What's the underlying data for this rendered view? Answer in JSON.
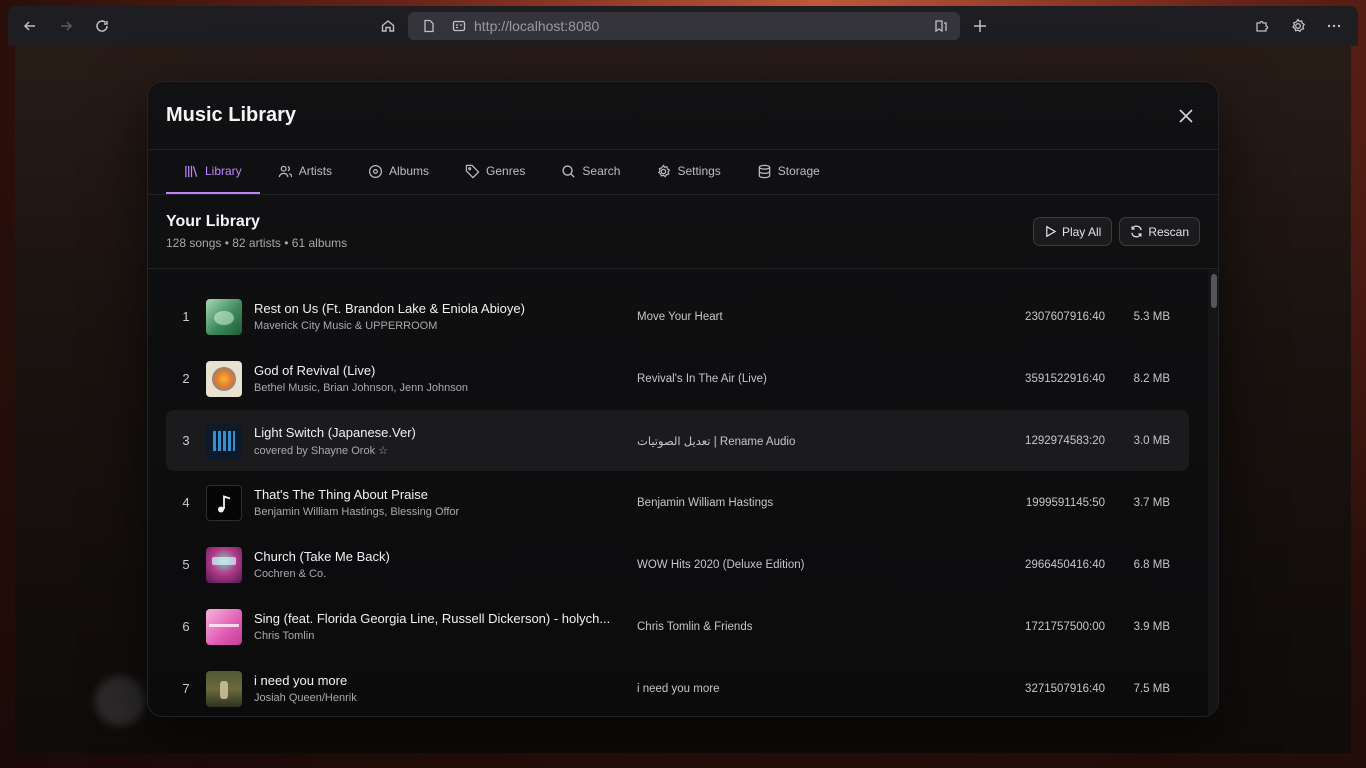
{
  "browser": {
    "url": "http://localhost:8080"
  },
  "modal": {
    "title": "Music Library",
    "tabs": [
      {
        "label": "Library",
        "icon": "library-icon",
        "active": true
      },
      {
        "label": "Artists",
        "icon": "users-icon"
      },
      {
        "label": "Albums",
        "icon": "disc-icon"
      },
      {
        "label": "Genres",
        "icon": "tag-icon"
      },
      {
        "label": "Search",
        "icon": "search-icon"
      },
      {
        "label": "Settings",
        "icon": "gear-icon"
      },
      {
        "label": "Storage",
        "icon": "database-icon"
      }
    ],
    "library": {
      "title": "Your Library",
      "stats": "128 songs • 82 artists • 61 albums",
      "play_all": "Play All",
      "rescan": "Rescan"
    },
    "songs": [
      {
        "num": "1",
        "title": "Rest on Us (Ft. Brandon Lake & Eniola Abioye)",
        "artist": "Maverick City Music & UPPERROOM",
        "album": "Move Your Heart",
        "duration": "2307607916:40",
        "size": "5.3 MB",
        "art": "green"
      },
      {
        "num": "2",
        "title": "God of Revival (Live)",
        "artist": "Bethel Music, Brian Johnson, Jenn Johnson",
        "album": "Revival's In The Air (Live)",
        "duration": "3591522916:40",
        "size": "8.2 MB",
        "art": "sun"
      },
      {
        "num": "3",
        "title": "Light Switch (Japanese.Ver)",
        "artist": "covered by Shayne Orok ☆",
        "album": "تعديل الصوتيات | Rename Audio",
        "duration": "1292974583:20",
        "size": "3.0 MB",
        "art": "blue"
      },
      {
        "num": "4",
        "title": "That's The Thing About Praise",
        "artist": "Benjamin William Hastings, Blessing Offor",
        "album": "Benjamin William Hastings",
        "duration": "1999591145:50",
        "size": "3.7 MB",
        "art": "note"
      },
      {
        "num": "5",
        "title": "Church (Take Me Back)",
        "artist": "Cochren & Co.",
        "album": "WOW Hits 2020 (Deluxe Edition)",
        "duration": "2966450416:40",
        "size": "6.8 MB",
        "art": "wow"
      },
      {
        "num": "6",
        "title": "Sing (feat. Florida Georgia Line, Russell Dickerson) - holych...",
        "artist": "Chris Tomlin",
        "album": "Chris Tomlin & Friends",
        "duration": "1721757500:00",
        "size": "3.9 MB",
        "art": "pink"
      },
      {
        "num": "7",
        "title": "i need you more",
        "artist": "Josiah Queen/Henrik",
        "album": "i need you more",
        "duration": "3271507916:40",
        "size": "7.5 MB",
        "art": "field"
      }
    ]
  }
}
